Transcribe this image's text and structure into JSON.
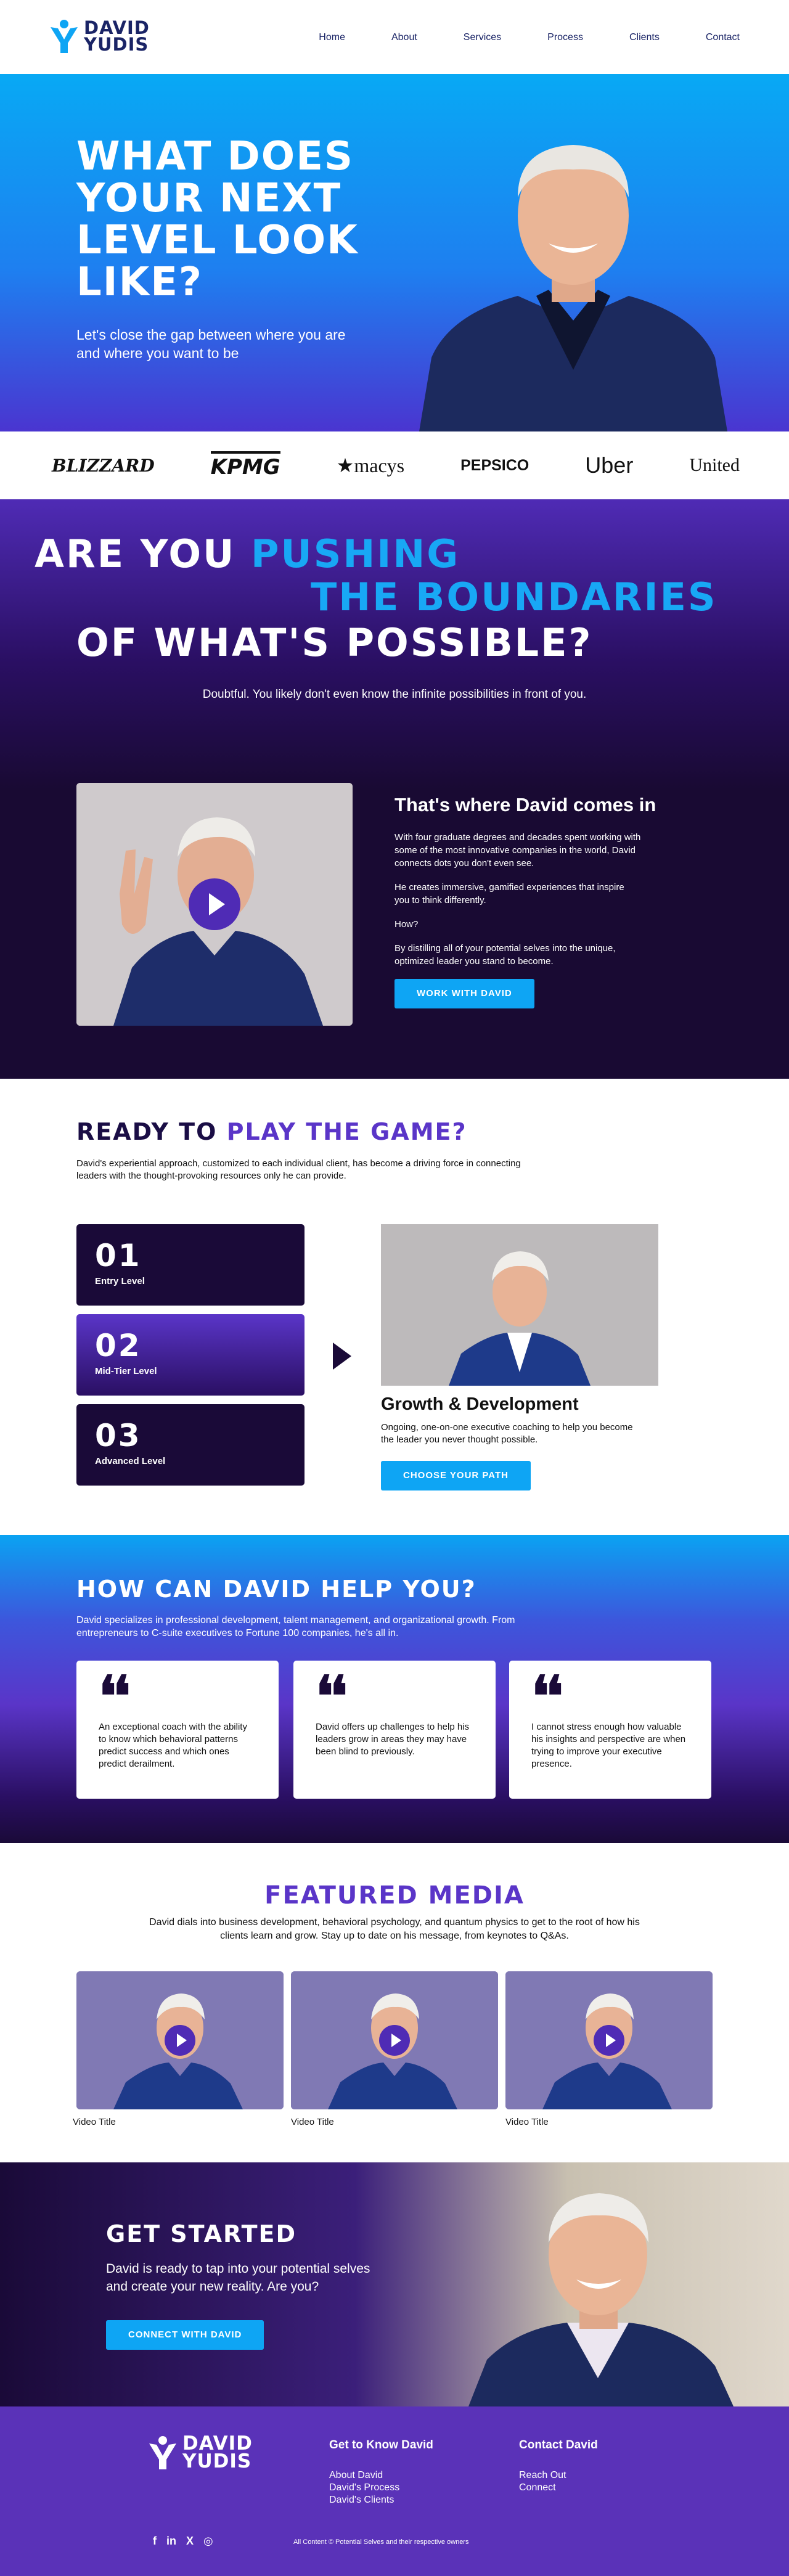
{
  "header": {
    "logo_line1": "DAVID",
    "logo_line2": "YUDIS",
    "nav": [
      "Home",
      "About",
      "Services",
      "Process",
      "Clients",
      "Contact"
    ]
  },
  "hero": {
    "title": "What does your next level look like?",
    "subtitle": "Let's close the gap between where you are and where you want to be"
  },
  "brands": [
    "BLIZZARD",
    "KPMG",
    "★macys",
    "PEPSICO",
    "Uber",
    "United"
  ],
  "pushing": {
    "line1_a": "Are you ",
    "line1_b": "pushing",
    "line2": "the boundaries",
    "line3": "of what's possible?",
    "subtitle": "Doubtful. You likely don't even know the infinite possibilities in front of you.",
    "heading": "That's where David comes in",
    "p1": "With four graduate degrees and decades spent working with some of the most innovative companies in the world, David connects dots you don't even see.",
    "p2": "He creates immersive, gamified experiences that inspire you to think differently.",
    "p3": "How?",
    "p4": "By distilling all of your potential selves into the unique, optimized leader you stand to become.",
    "button": "Work with David"
  },
  "game": {
    "title_a": "Ready to ",
    "title_b": "play the game?",
    "subtitle": "David's experiential approach, customized to each individual client, has become a driving force in connecting leaders with the thought-provoking resources only he can provide.",
    "levels": [
      {
        "num": "01",
        "label": "Entry Level"
      },
      {
        "num": "02",
        "label": "Mid-Tier Level"
      },
      {
        "num": "03",
        "label": "Advanced Level"
      }
    ],
    "growth_title": "Growth & Development",
    "growth_desc": "Ongoing, one-on-one executive coaching to help you become the leader you never thought possible.",
    "button": "Choose your path"
  },
  "help": {
    "title": "How can David help you?",
    "subtitle": "David specializes in professional development, talent management, and organizational growth. From entrepreneurs to C-suite executives to Fortune 100 companies, he's all in.",
    "testimonials": [
      "An exceptional coach with the ability to know which behavioral patterns predict success and which ones predict derailment.",
      "David offers up challenges to help his leaders grow in areas they may have been blind to previously.",
      "I cannot stress enough how valuable his insights and perspective are when trying to improve your executive presence."
    ]
  },
  "media": {
    "title": "Featured Media",
    "subtitle": "David dials into business development, behavioral psychology, and quantum physics to get to the root of how his clients learn and grow. Stay up to date on his message, from keynotes to Q&As.",
    "videos": [
      "Video Title",
      "Video Title",
      "Video Title"
    ]
  },
  "started": {
    "title": "Get started",
    "subtitle": "David is ready to tap into your potential selves and create your new reality. Are you?",
    "button": "Connect with David"
  },
  "footer": {
    "col1_title": "Get to Know David",
    "col1_links": [
      "About David",
      "David's Process",
      "David's Clients"
    ],
    "col2_title": "Contact David",
    "col2_links": [
      "Reach Out",
      "Connect"
    ],
    "social": [
      "f",
      "in",
      "X",
      "◎"
    ],
    "copyright": "All Content © Potential Selves and their respective owners"
  },
  "colors": {
    "primary_blue": "#0ea5f4",
    "purple": "#5a35c8",
    "dark_navy": "#1a0a38",
    "logo_navy": "#1a2466"
  }
}
